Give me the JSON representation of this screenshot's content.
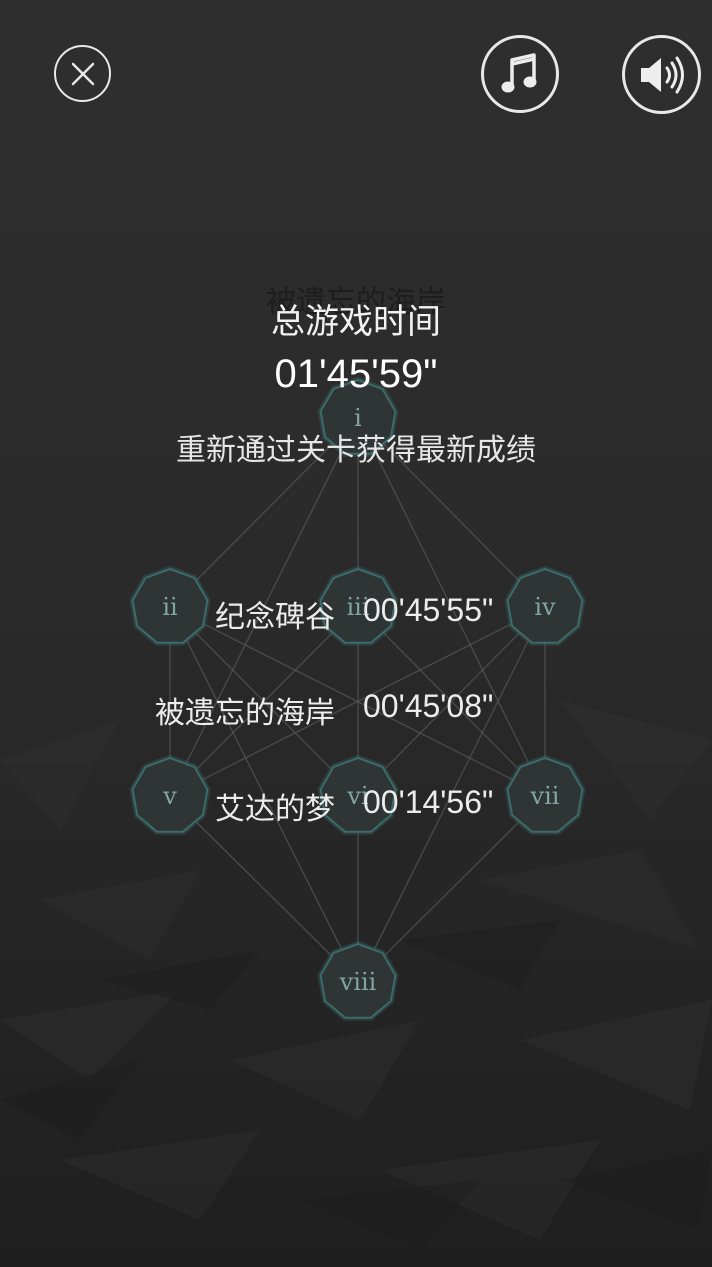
{
  "toolbar": {
    "close_icon": "close-icon",
    "music_icon": "music-note-icon",
    "sound_icon": "speaker-volume-icon"
  },
  "background_title": "被遗忘的海岸",
  "summary": {
    "total_label": "总游戏时间",
    "total_time": "01'45'59\"",
    "hint": "重新通过关卡获得最新成绩"
  },
  "records": [
    {
      "name": "纪念碑谷",
      "time": "00'45'55\""
    },
    {
      "name": "被遗忘的海岸",
      "time": "00'45'08\""
    },
    {
      "name": "艾达的梦",
      "time": "00'14'56\""
    }
  ],
  "level_nodes": [
    "i",
    "ii",
    "iii",
    "iv",
    "v",
    "vi",
    "vii",
    "viii"
  ],
  "colors": {
    "node_fill": "#2f3434",
    "node_stroke": "#3b6b6a",
    "line": "#5a5a5a"
  }
}
